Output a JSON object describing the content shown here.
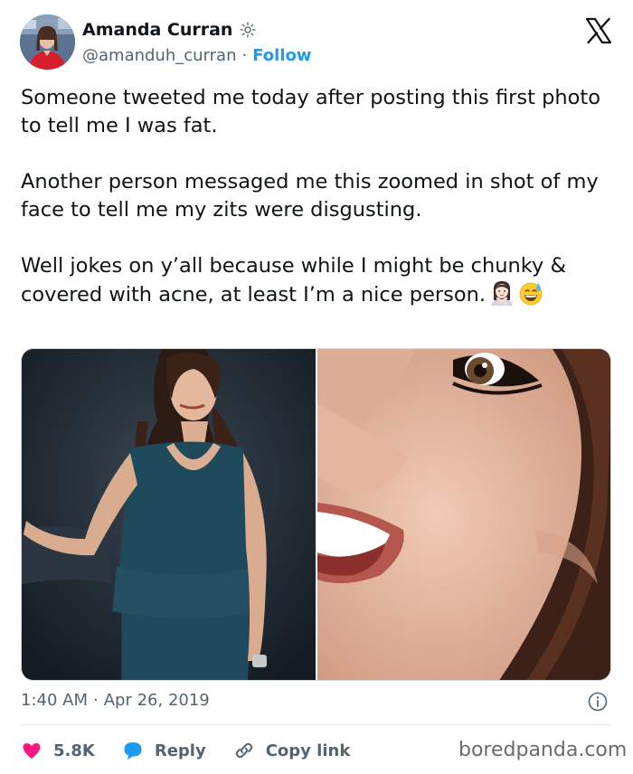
{
  "author": {
    "name": "Amanda Curran",
    "handle": "@amanduh_curran",
    "separator": "·",
    "follow_label": "Follow"
  },
  "tweet": {
    "paragraphs": [
      "Someone tweeted me today after posting this first photo to tell me I was fat.",
      "Another person messaged me this zoomed in shot of my face to tell me my zits were disgusting.",
      "Well jokes on y’all because while I might be chunky & covered with acne, at least I’m a nice person."
    ],
    "emojis": [
      "person-gesturing-no",
      "grinning-sweat-face"
    ]
  },
  "timestamp": {
    "time": "1:40 AM",
    "separator": "·",
    "date": "Apr 26, 2019"
  },
  "actions": {
    "likes": "5.8K",
    "reply_label": "Reply",
    "copy_label": "Copy link"
  },
  "watermark": "boredpanda.com",
  "icons": {
    "brand": "x-logo-icon",
    "badge": "sun-badge-icon",
    "info": "info-icon",
    "like": "heart-icon",
    "reply": "speech-bubble-icon",
    "copy": "link-icon"
  },
  "colors": {
    "follow": "#1d9bf0",
    "heart": "#f91880",
    "reply_bubble": "#1d9bf0",
    "text": "#0f1419",
    "muted": "#536471"
  }
}
